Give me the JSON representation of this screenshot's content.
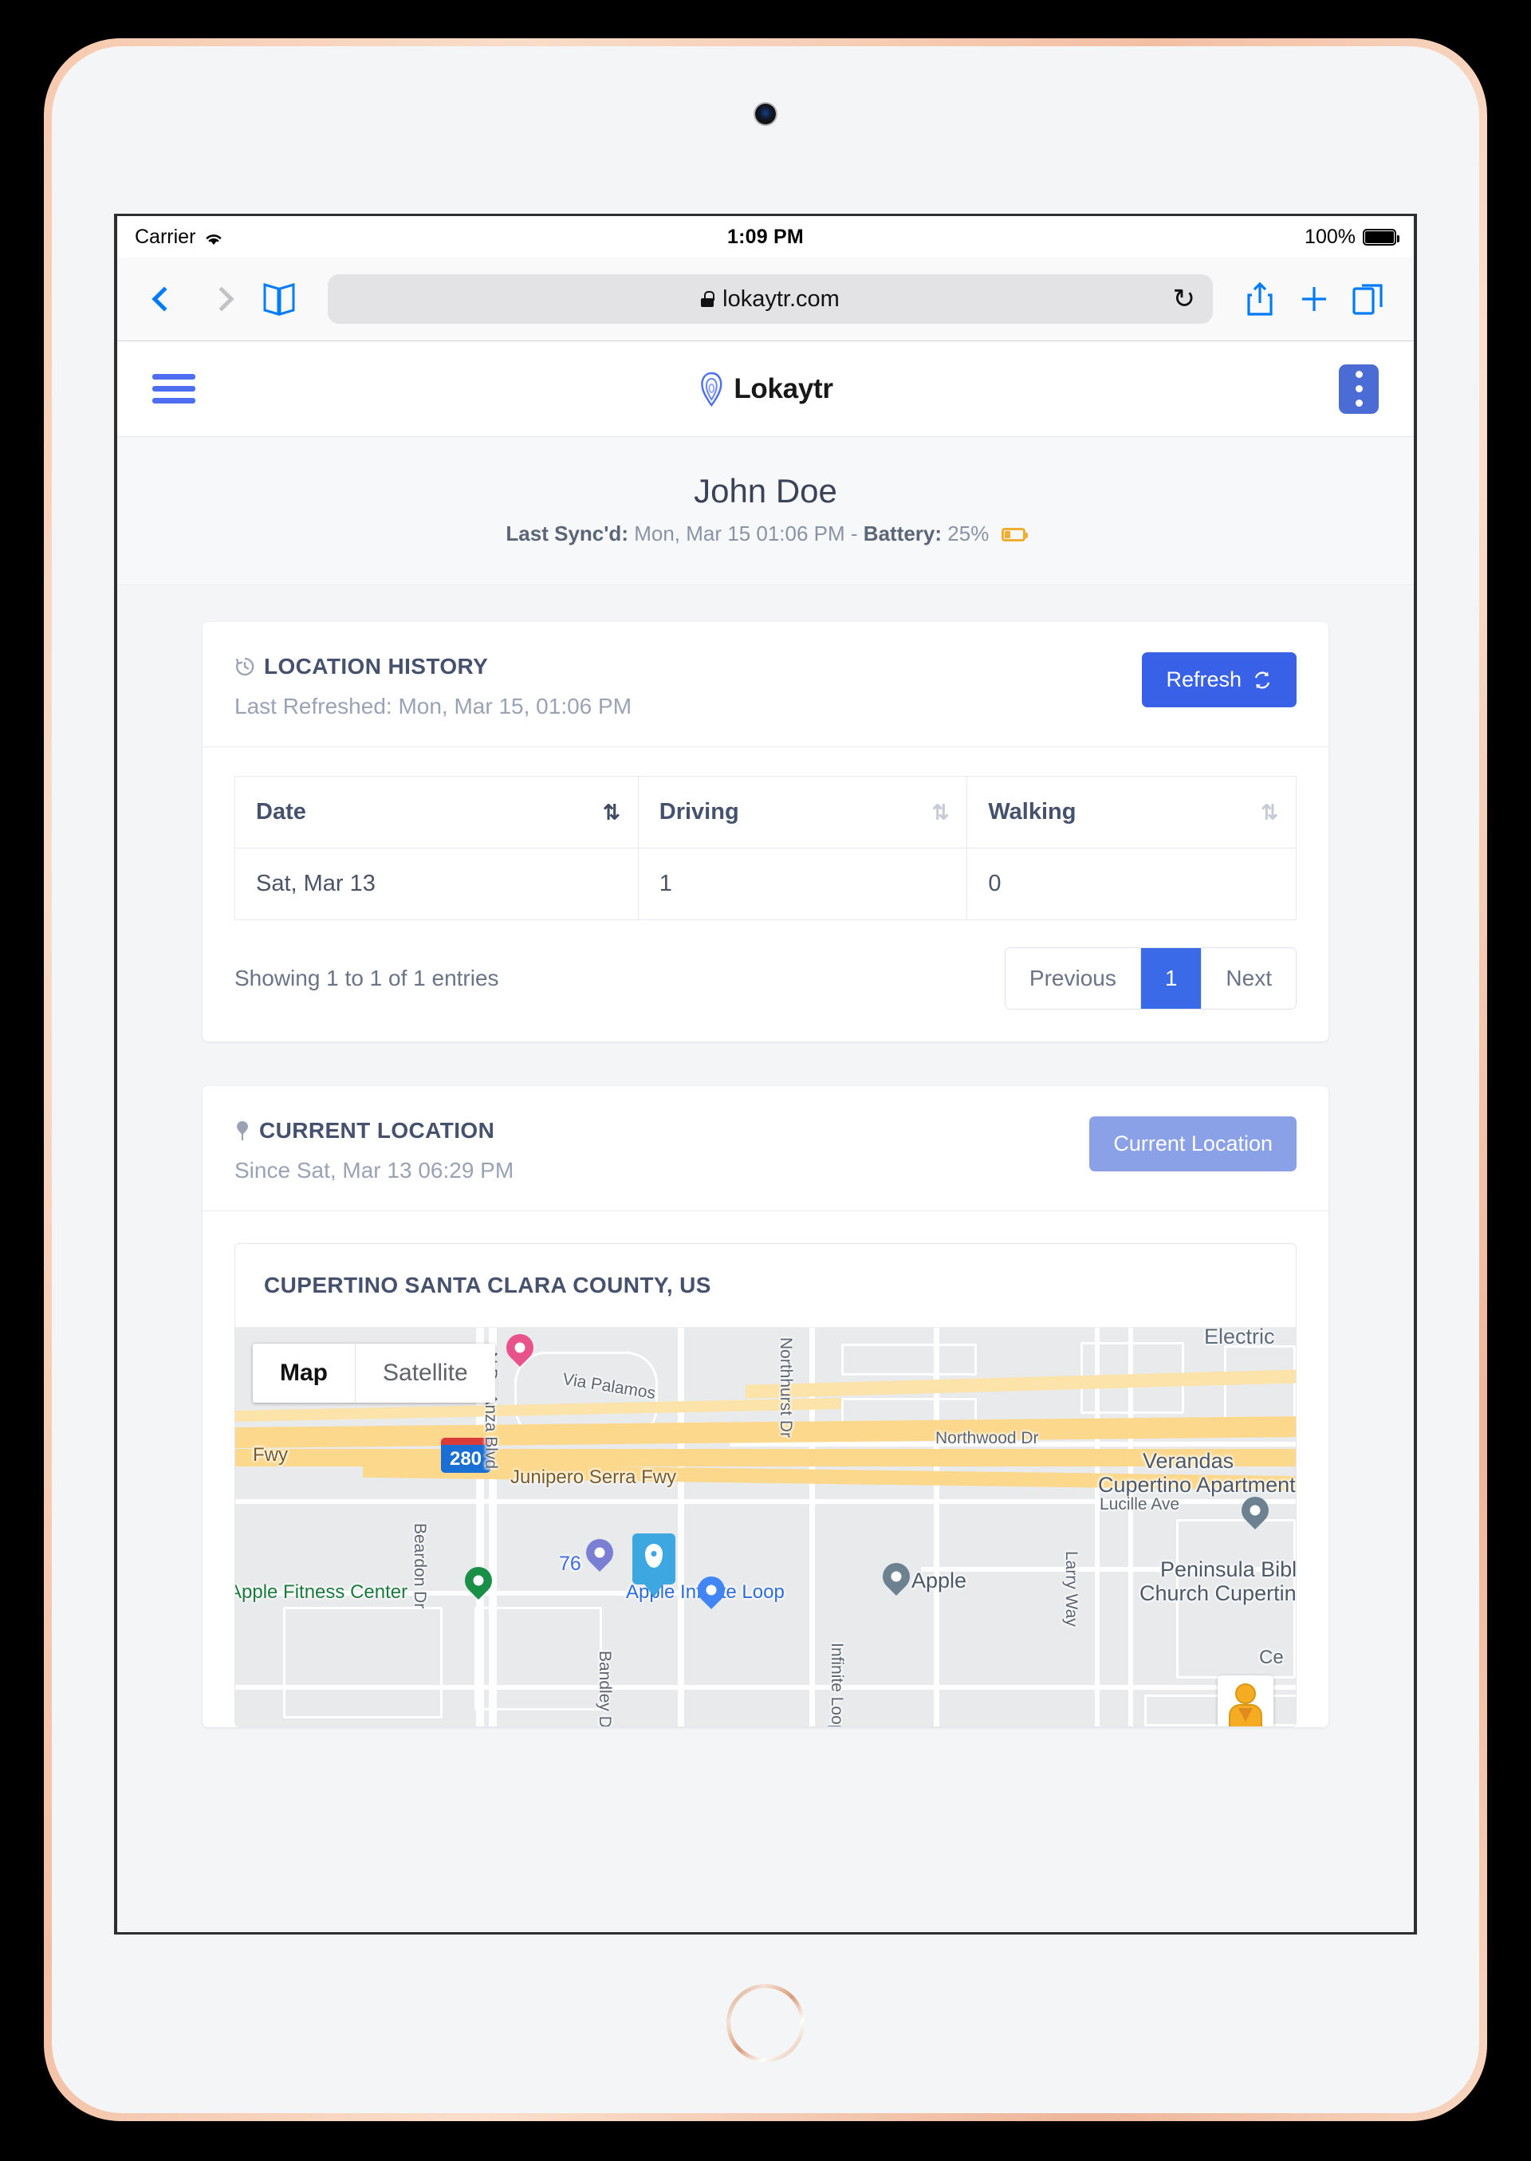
{
  "status_bar": {
    "carrier": "Carrier",
    "wifi_icon": "wifi-icon",
    "time": "1:09 PM",
    "battery_percent": "100%",
    "battery_icon": "battery-full-icon"
  },
  "safari": {
    "back_icon": "chevron-left-icon",
    "forward_icon": "chevron-right-icon",
    "bookmarks_icon": "book-icon",
    "lock_icon": "lock-icon",
    "url": "lokaytr.com",
    "reload_icon": "reload-icon",
    "share_icon": "share-icon",
    "new_tab_icon": "plus-icon",
    "tabs_icon": "tabs-icon"
  },
  "app_header": {
    "menu_icon": "hamburger-menu-icon",
    "logo_icon": "location-pin-logo-icon",
    "brand": "Lokaytr",
    "overflow_icon": "kebab-menu-icon"
  },
  "user": {
    "name": "John Doe",
    "last_sync_label": "Last Sync'd:",
    "last_sync_value": "Mon, Mar 15 01:06 PM",
    "separator": " - ",
    "battery_label": "Battery:",
    "battery_value": "25%",
    "battery_icon": "battery-low-icon"
  },
  "location_history": {
    "icon": "history-clock-icon",
    "title": "LOCATION HISTORY",
    "subtitle": "Last Refreshed: Mon, Mar 15, 01:06 PM",
    "refresh_label": "Refresh",
    "refresh_icon": "sync-icon",
    "columns": [
      "Date",
      "Driving",
      "Walking"
    ],
    "sort_icon": "sort-updown-icon",
    "rows": [
      {
        "date": "Sat, Mar 13",
        "driving": "1",
        "walking": "0"
      }
    ],
    "entries_info": "Showing 1 to 1 of 1 entries",
    "pagination": {
      "previous": "Previous",
      "pages": [
        "1"
      ],
      "next": "Next",
      "active_page": "1"
    }
  },
  "current_location": {
    "icon": "map-pin-icon",
    "title": "CURRENT LOCATION",
    "subtitle": "Since Sat, Mar 13 06:29 PM",
    "button_label": "Current Location",
    "place_title": "CUPERTINO SANTA CLARA COUNTY, US",
    "map": {
      "toggle_map": "Map",
      "toggle_satellite": "Satellite",
      "active_toggle": "Map",
      "street_view_icon": "pegman-icon",
      "highway_shield": "280",
      "labels": [
        "N De Anza Blvd",
        "Via Palamos",
        "Northhurst Dr",
        "Northwood Dr",
        "Junipero Serra Fwy",
        "Fwy",
        "Verandas",
        "Cupertino Apartments",
        "Lucille Ave",
        "Electric",
        "Beardon Dr",
        "Bandley Dr",
        "Apple Fitness Center",
        "Apple Infinite Loop",
        "Apple",
        "Larry Way",
        "Infinite Loop",
        "Peninsula Bible",
        "Church Cupertino",
        "76",
        "Ce"
      ]
    }
  },
  "colors": {
    "accent_blue": "#3961e8",
    "muted_blue": "#8aa1e8",
    "brand_blue": "#4e6ef2",
    "battery_orange": "#f0ad32",
    "page_bg": "#f4f5f7",
    "text_dark": "#46516d"
  }
}
